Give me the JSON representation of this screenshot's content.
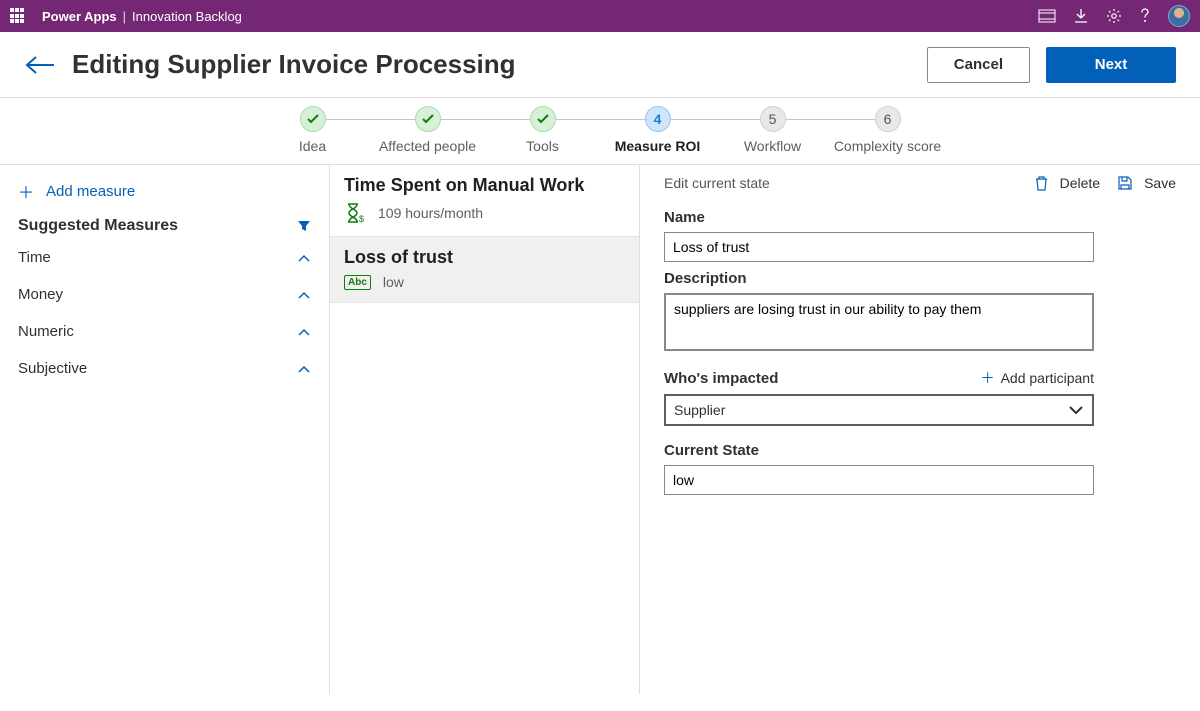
{
  "topbar": {
    "brand": "Power Apps",
    "app": "Innovation Backlog"
  },
  "header": {
    "title": "Editing Supplier Invoice Processing",
    "cancel": "Cancel",
    "next": "Next"
  },
  "stepper": [
    {
      "label": "Idea",
      "state": "done"
    },
    {
      "label": "Affected people",
      "state": "done"
    },
    {
      "label": "Tools",
      "state": "done"
    },
    {
      "label": "Measure ROI",
      "state": "current",
      "num": "4"
    },
    {
      "label": "Workflow",
      "state": "todo",
      "num": "5"
    },
    {
      "label": "Complexity score",
      "state": "todo",
      "num": "6"
    }
  ],
  "sidebar": {
    "add": "Add measure",
    "heading": "Suggested Measures",
    "cats": [
      "Time",
      "Money",
      "Numeric",
      "Subjective"
    ]
  },
  "cards": [
    {
      "title": "Time Spent on Manual Work",
      "value": "109 hours/month"
    },
    {
      "title": "Loss of trust",
      "value": "low"
    }
  ],
  "form": {
    "edit_label": "Edit current state",
    "delete": "Delete",
    "save": "Save",
    "name_label": "Name",
    "name_value": "Loss of trust",
    "desc_label": "Description",
    "desc_value": "suppliers are losing trust in our ability to pay them",
    "impact_label": "Who's impacted",
    "add_participant": "Add participant",
    "impact_value": "Supplier",
    "state_label": "Current State",
    "state_value": "low"
  }
}
